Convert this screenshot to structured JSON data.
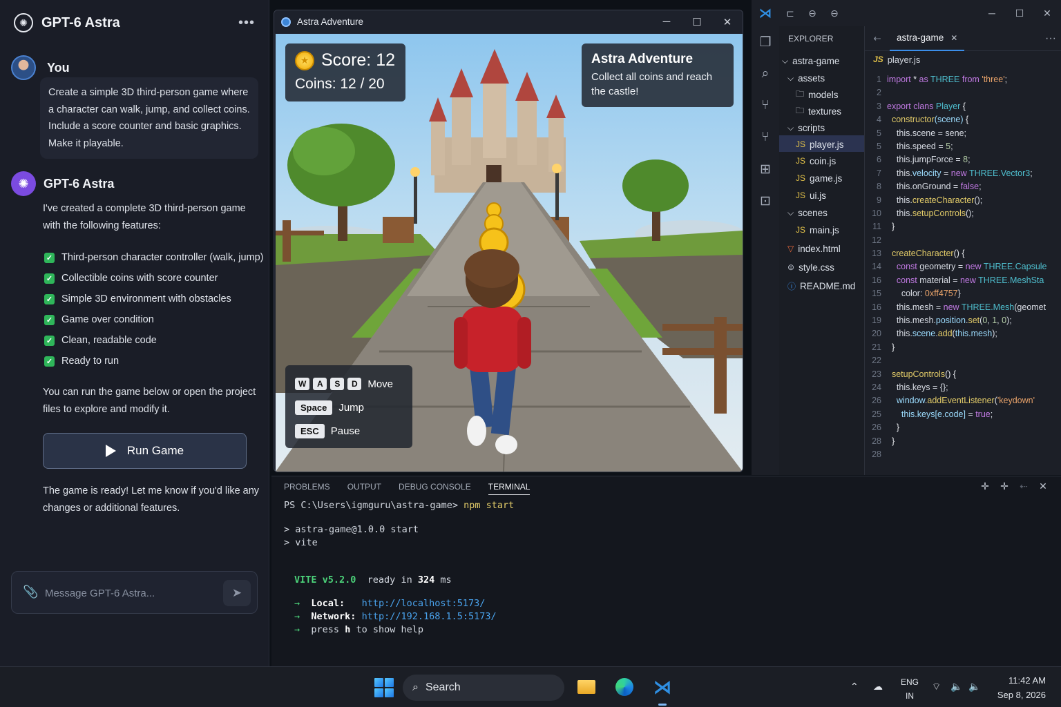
{
  "chat": {
    "app_title": "GPT-6 Astra",
    "menu_icon": "more-dots-icon",
    "user": {
      "name": "You",
      "message": "Create a simple 3D third-person game where a character can walk, jump, and collect coins. Include a score counter and basic graphics. Make it playable."
    },
    "assistant": {
      "name": "GPT-6 Astra",
      "intro": "I've created a complete 3D third-person game with the following features:",
      "features": [
        "Third-person character controller (walk, jump)",
        "Collectible coins with score counter",
        "Simple 3D environment with obstacles",
        "Game over condition",
        "Clean, readable code",
        "Ready to run"
      ],
      "run_text": "You can run the game below or open the project files to explore and modify it.",
      "run_button": "Run Game",
      "final": "The game is ready! Let me know if you'd like any changes or additional features."
    },
    "composer": {
      "placeholder": "Message GPT-6 Astra..."
    }
  },
  "game": {
    "window_title": "Astra Adventure",
    "score": "Score: 12",
    "coins": "Coins: 12 / 20",
    "info_title": "Astra Adventure",
    "info_text": "Collect all coins and reach the castle!",
    "controls": [
      {
        "keys": [
          "W",
          "A",
          "S",
          "D"
        ],
        "action": "Move"
      },
      {
        "keys": [
          "Space"
        ],
        "action": "Jump"
      },
      {
        "keys": [
          "ESC"
        ],
        "action": "Pause"
      }
    ]
  },
  "vscode": {
    "explorer_title": "EXPLORER",
    "tree": [
      {
        "label": "astra-game",
        "type": "root"
      },
      {
        "label": "assets",
        "type": "folder-open"
      },
      {
        "label": "models",
        "type": "folder"
      },
      {
        "label": "textures",
        "type": "folder"
      },
      {
        "label": "scripts",
        "type": "folder-open"
      },
      {
        "label": "player.js",
        "type": "js"
      },
      {
        "label": "coin.js",
        "type": "js"
      },
      {
        "label": "game.js",
        "type": "js"
      },
      {
        "label": "ui.js",
        "type": "js"
      },
      {
        "label": "scenes",
        "type": "folder-open"
      },
      {
        "label": "main.js",
        "type": "js"
      },
      {
        "label": "index.html",
        "type": "html"
      },
      {
        "label": "style.css",
        "type": "css"
      },
      {
        "label": "README.md",
        "type": "md"
      }
    ],
    "tab": "astra-game",
    "breadcrumb": "player.js",
    "line_numbers": [
      "1",
      "2",
      "3",
      "4",
      "5",
      "5",
      "6",
      "7",
      "8",
      "9",
      "10",
      "11",
      "12",
      "13",
      "14",
      "16",
      "15",
      "16",
      "19",
      "20",
      "21",
      "22",
      "23",
      "24",
      "26",
      "25",
      "26",
      "28",
      "28"
    ],
    "accent": "#3b8eea"
  },
  "terminal": {
    "tabs": [
      "PROBLEMS",
      "OUTPUT",
      "DEBUG CONSOLE",
      "TERMINAL"
    ],
    "prompt": "PS C:\\Users\\igmguru\\astra-game>",
    "command": "npm start",
    "line1": "> astra-game@1.0.0 start",
    "line2": "> vite",
    "vite_name": "VITE v5.2.0",
    "ready_text": "ready in",
    "ready_ms": "324",
    "ms_unit": "ms",
    "local_label": "Local:",
    "local_url": "http://localhost:5173/",
    "network_label": "Network:",
    "network_url": "http://192.168.1.5:5173/",
    "help_pre": "press",
    "help_key": "h",
    "help_post": "to show help"
  },
  "taskbar": {
    "search": "Search",
    "lang_top": "ENG",
    "lang_bottom": "IN",
    "time": "11:42 AM",
    "date": "Sep 8, 2026"
  }
}
